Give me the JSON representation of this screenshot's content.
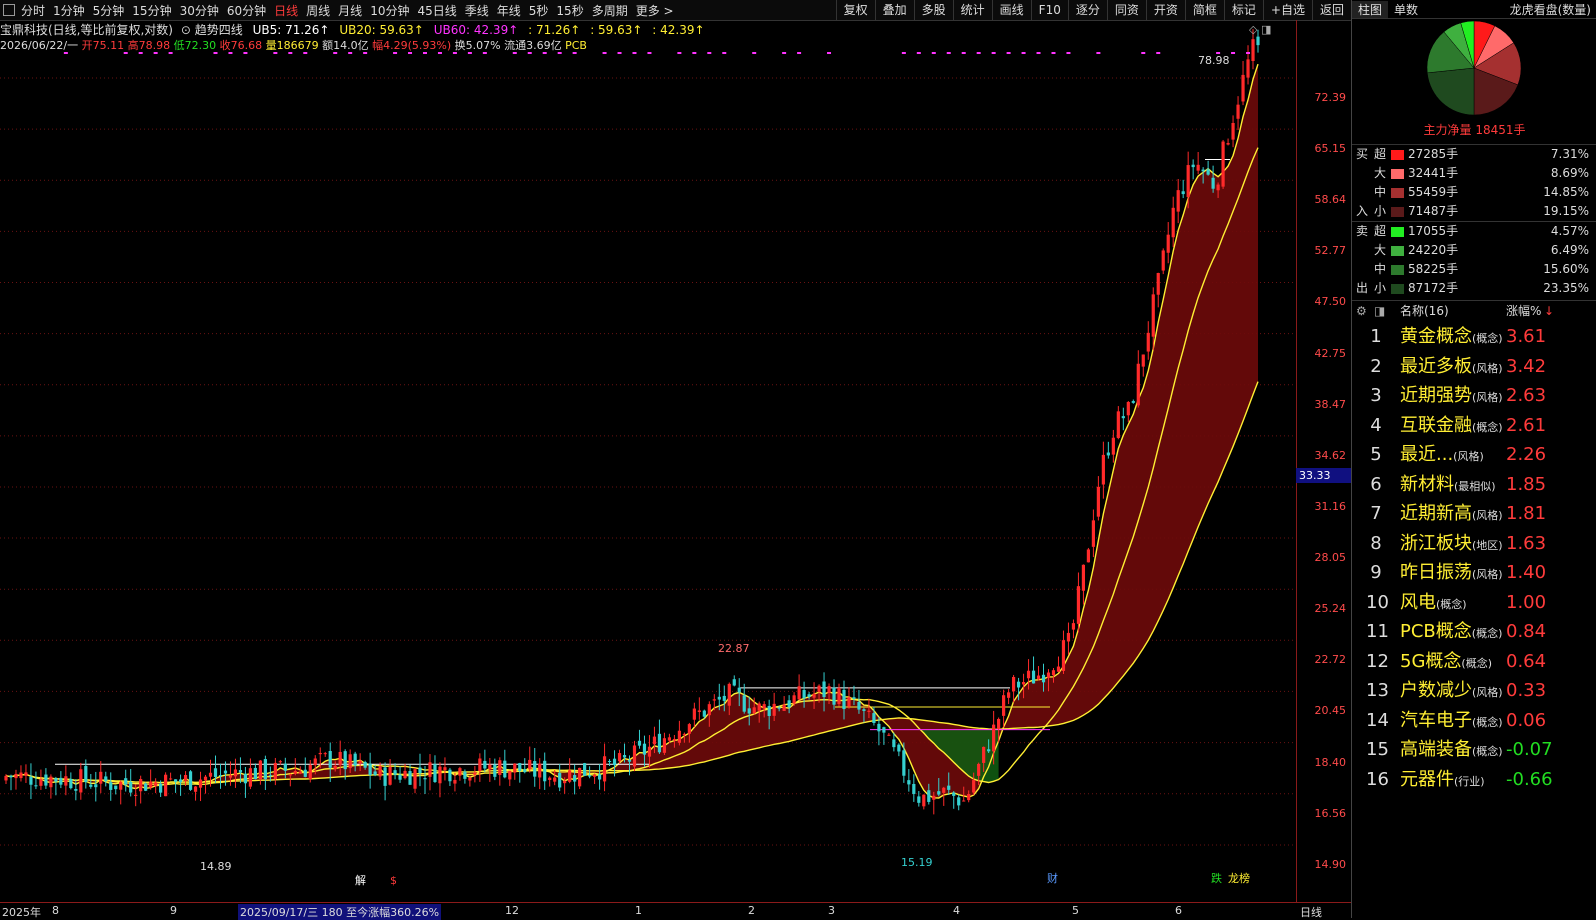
{
  "menu": {
    "periods": [
      "分时",
      "1分钟",
      "5分钟",
      "15分钟",
      "30分钟",
      "60分钟",
      "日线",
      "周线",
      "月线",
      "10分钟",
      "45日线",
      "季线",
      "年线",
      "5秒",
      "15秒",
      "多周期",
      "更多 >"
    ],
    "active_period": "日线",
    "tools": [
      "复权",
      "叠加",
      "多股",
      "统计",
      "画线",
      "F10",
      "逐分",
      "同资",
      "开资",
      "简框",
      "标记",
      "+自选",
      "返回"
    ]
  },
  "title": {
    "stock": "宝鼎科技(日线,等比前复权,对数)",
    "indicator": "趋势四线",
    "ub5": "UB5: 71.26↑",
    "ub20": "UB20: 59.63↑",
    "ub60": "UB60: 42.39↑",
    "v1": ": 71.26↑",
    "v2": ": 59.63↑",
    "v3": ": 42.39↑"
  },
  "info": {
    "date": "2026/06/22/一",
    "open": "开75.11",
    "high": "高78.98",
    "low": "低72.30",
    "close": "收76.68",
    "volume": "量186679",
    "amount": "额14.0亿",
    "change": "幅4.29(5.93%)",
    "turnover": "换5.07%",
    "float": "流通3.69亿",
    "tag": "PCB"
  },
  "price_axis": [
    "72.39",
    "65.15",
    "58.64",
    "52.77",
    "47.50",
    "42.75",
    "38.47",
    "34.62",
    "31.16",
    "28.05",
    "25.24",
    "22.72",
    "20.45",
    "18.40",
    "16.56",
    "14.90"
  ],
  "current_price": "33.33",
  "annotations": {
    "high": "78.98",
    "peak1": "22.87",
    "low1": "14.89",
    "low2": "15.19",
    "badge_split": "解",
    "badge_s": "$",
    "badge_cai": "财",
    "badge_die": "跌",
    "badge_lhb": "龙榜"
  },
  "date_axis": {
    "labels": [
      "2025年",
      "8",
      "9",
      "12",
      "1",
      "2",
      "3",
      "4",
      "5",
      "6"
    ],
    "range_note": "2025/09/17/三 180 至今涨幅360.26%",
    "period": "日线"
  },
  "right_panel": {
    "tabs": [
      "柱图",
      "单数"
    ],
    "title": "龙虎看盘(数量)",
    "main_flow": "主力净量 18451手",
    "buy_label": [
      "买",
      "入"
    ],
    "sell_label": [
      "卖",
      "出"
    ],
    "buy": [
      {
        "lvl": "超",
        "vol": "27285手",
        "pct": "7.31%",
        "color": "#ff1a1a"
      },
      {
        "lvl": "大",
        "vol": "32441手",
        "pct": "8.69%",
        "color": "#ff6a6a"
      },
      {
        "lvl": "中",
        "vol": "55459手",
        "pct": "14.85%",
        "color": "#a53030"
      },
      {
        "lvl": "小",
        "vol": "71487手",
        "pct": "19.15%",
        "color": "#5a1a1a"
      }
    ],
    "sell": [
      {
        "lvl": "超",
        "vol": "17055手",
        "pct": "4.57%",
        "color": "#22ee22"
      },
      {
        "lvl": "大",
        "vol": "24220手",
        "pct": "6.49%",
        "color": "#3fb03f"
      },
      {
        "lvl": "中",
        "vol": "58225手",
        "pct": "15.60%",
        "color": "#2d7a2d"
      },
      {
        "lvl": "小",
        "vol": "87172手",
        "pct": "23.35%",
        "color": "#1f4a1f"
      }
    ],
    "sector_header": {
      "name": "名称(16)",
      "chg": "涨幅%"
    },
    "sectors": [
      {
        "n": "1",
        "name": "黄金概念",
        "tag": "(概念)",
        "chg": "3.61",
        "color": "#ff3b3b"
      },
      {
        "n": "2",
        "name": "最近多板",
        "tag": "(风格)",
        "chg": "3.42",
        "color": "#ff3b3b"
      },
      {
        "n": "3",
        "name": "近期强势",
        "tag": "(风格)",
        "chg": "2.63",
        "color": "#ff3b3b"
      },
      {
        "n": "4",
        "name": "互联金融",
        "tag": "(概念)",
        "chg": "2.61",
        "color": "#ff3b3b"
      },
      {
        "n": "5",
        "name": "最近...",
        "tag": "(风格)",
        "chg": "2.26",
        "color": "#ff3b3b"
      },
      {
        "n": "6",
        "name": "新材料",
        "tag": "(最相似)",
        "chg": "1.85",
        "color": "#ff3b3b"
      },
      {
        "n": "7",
        "name": "近期新高",
        "tag": "(风格)",
        "chg": "1.81",
        "color": "#ff3b3b"
      },
      {
        "n": "8",
        "name": "浙江板块",
        "tag": "(地区)",
        "chg": "1.63",
        "color": "#ff3b3b"
      },
      {
        "n": "9",
        "name": "昨日振荡",
        "tag": "(风格)",
        "chg": "1.40",
        "color": "#ff3b3b"
      },
      {
        "n": "10",
        "name": "风电",
        "tag": "(概念)",
        "chg": "1.00",
        "color": "#ff3b3b"
      },
      {
        "n": "11",
        "name": "PCB概念",
        "tag": "(概念)",
        "chg": "0.84",
        "color": "#ff3b3b"
      },
      {
        "n": "12",
        "name": "5G概念",
        "tag": "(概念)",
        "chg": "0.64",
        "color": "#ff3b3b"
      },
      {
        "n": "13",
        "name": "户数减少",
        "tag": "(风格)",
        "chg": "0.33",
        "color": "#ff3b3b"
      },
      {
        "n": "14",
        "name": "汽车电子",
        "tag": "(概念)",
        "chg": "0.06",
        "color": "#ff3b3b"
      },
      {
        "n": "15",
        "name": "高端装备",
        "tag": "(概念)",
        "chg": "-0.07",
        "color": "#22dd22"
      },
      {
        "n": "16",
        "name": "元器件",
        "tag": "(行业)",
        "chg": "-0.66",
        "color": "#22dd22"
      }
    ]
  }
}
